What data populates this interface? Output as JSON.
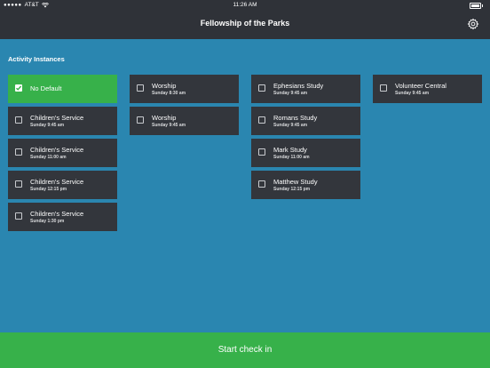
{
  "status_bar": {
    "carrier": "AT&T",
    "time": "11:26 AM"
  },
  "header": {
    "title": "Fellowship of the Parks",
    "settings_icon": "gear-icon"
  },
  "section_label": "Activity Instances",
  "columns": [
    [
      {
        "name": "No Default",
        "time": "",
        "selected": true
      },
      {
        "name": "Children's Service",
        "time": "Sunday 9:45 am",
        "selected": false
      },
      {
        "name": "Children's Service",
        "time": "Sunday 11:00 am",
        "selected": false
      },
      {
        "name": "Children's Service",
        "time": "Sunday 12:15 pm",
        "selected": false
      },
      {
        "name": "Children's Service",
        "time": "Sunday 1:30 pm",
        "selected": false
      }
    ],
    [
      {
        "name": "Worship",
        "time": "Sunday 8:30 am",
        "selected": false
      },
      {
        "name": "Worship",
        "time": "Sunday 9:45 am",
        "selected": false
      }
    ],
    [
      {
        "name": "Ephesians Study",
        "time": "Sunday 9:45 am",
        "selected": false
      },
      {
        "name": "Romans Study",
        "time": "Sunday 9:45 am",
        "selected": false
      },
      {
        "name": "Mark Study",
        "time": "Sunday 11:00 am",
        "selected": false
      },
      {
        "name": "Matthew Study",
        "time": "Sunday 12:15 pm",
        "selected": false
      }
    ],
    [
      {
        "name": "Volunteer Central",
        "time": "Sunday 9:45 am",
        "selected": false
      }
    ]
  ],
  "footer": {
    "start_label": "Start check in"
  },
  "colors": {
    "background": "#2a86b0",
    "card": "#33363c",
    "selected": "#37b14a",
    "bar": "#2f3238"
  }
}
